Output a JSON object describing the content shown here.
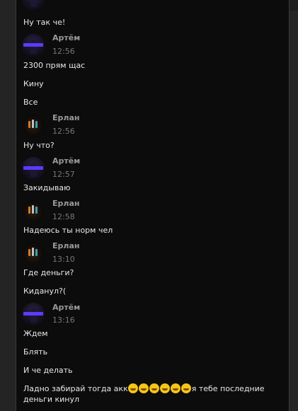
{
  "users": {
    "artem": "Артём",
    "erlan": "Ерлан"
  },
  "messages": [
    {
      "text": "Ну так че!"
    },
    {
      "author": "Артём",
      "time": "12:56"
    },
    {
      "text": "2300 прям щас"
    },
    {
      "text": "Кину"
    },
    {
      "text": "Все"
    },
    {
      "author": "Ерлан",
      "time": "12:56"
    },
    {
      "text": "Ну что?"
    },
    {
      "author": "Артём",
      "time": "12:57"
    },
    {
      "text": "Закидываю"
    },
    {
      "author": "Ерлан",
      "time": "12:58"
    },
    {
      "text": "Надеюсь ты норм чел"
    },
    {
      "author": "Ерлан",
      "time": "13:10"
    },
    {
      "text": "Где деньги?"
    },
    {
      "text": "Киданул?("
    },
    {
      "author": "Артём",
      "time": "13:16"
    },
    {
      "text": "Ждем"
    },
    {
      "text": "Блять"
    },
    {
      "text": "И че делать"
    },
    {
      "text_start": "Ладно забирай тогда акк",
      "emoji_count": 6,
      "emoji_name": "loudly-crying-face",
      "text_end": "я тебе последние деньги кинул"
    }
  ],
  "colors": {
    "background": "#0c0c0c",
    "artem_accent": "#5b3cff"
  }
}
